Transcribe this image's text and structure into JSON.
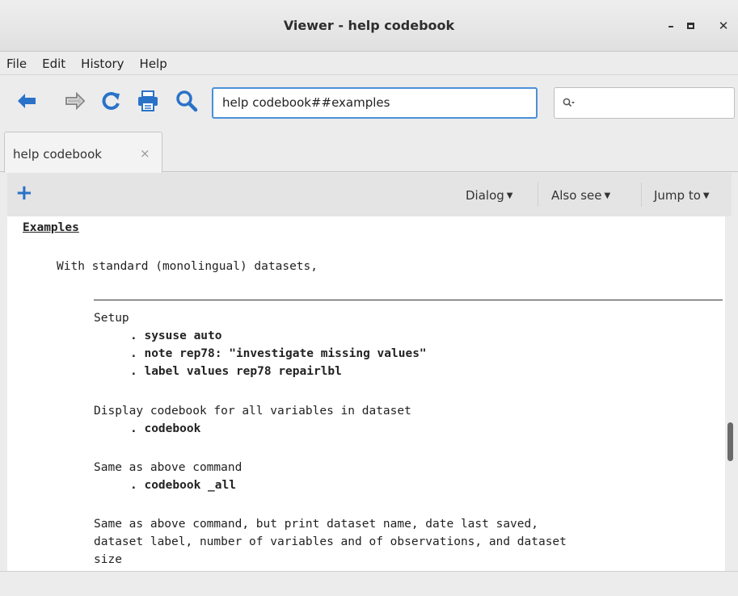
{
  "window": {
    "title": "Viewer - help codebook",
    "minimize_label": "–",
    "close_label": "✕"
  },
  "menu": {
    "file": "File",
    "edit": "Edit",
    "history": "History",
    "help": "Help"
  },
  "toolbar": {
    "address_value": "help codebook##examples",
    "search_placeholder": ""
  },
  "tabs": [
    {
      "label": "help codebook",
      "close": "×"
    }
  ],
  "help_toolbar": {
    "add_label": "+",
    "dialog": "Dialog",
    "also_see": "Also see",
    "jump_to": "Jump to",
    "caret": "▼"
  },
  "content": {
    "heading": "Examples",
    "intro": "With standard (monolingual) datasets,",
    "setup_label": "Setup",
    "cmd_sysuse": ". sysuse auto",
    "cmd_note": ". note rep78: \"investigate missing values\"",
    "cmd_label": ". label values rep78 repairlbl",
    "display_all_desc": "Display codebook for all variables in dataset",
    "cmd_codebook": ". codebook",
    "same_as_above": "Same as above command",
    "cmd_codebook_all": ". codebook _all",
    "same_print_1": "Same as above command, but print dataset name, date last saved,",
    "same_print_2": "dataset label, number of variables and of observations, and dataset",
    "same_print_3": "size"
  },
  "colors": {
    "accent": "#2a72c8",
    "focus_border": "#4a90d9"
  }
}
